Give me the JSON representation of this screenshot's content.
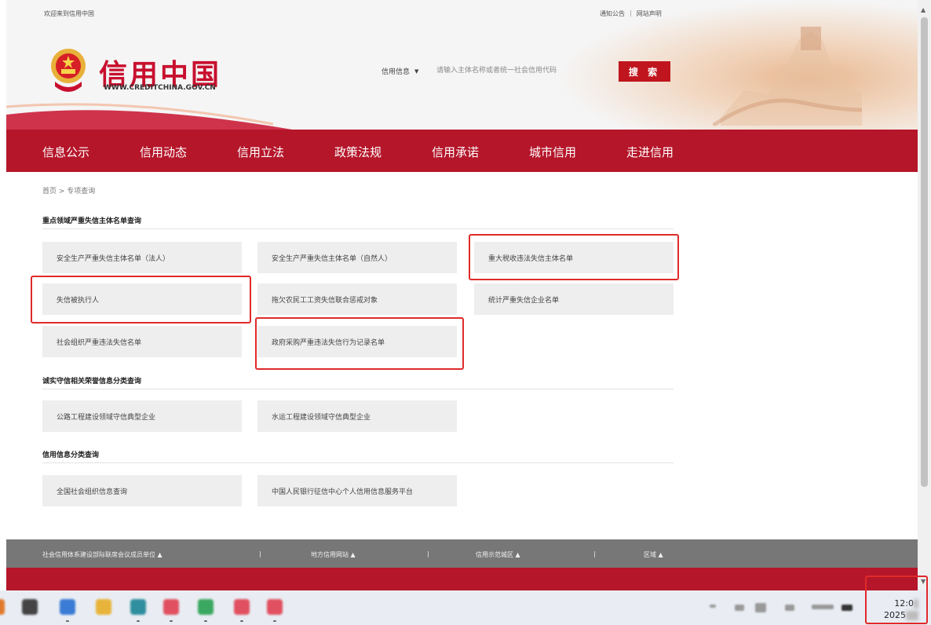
{
  "header": {
    "welcome": "欢迎来到信用中国",
    "notice": "通知公告",
    "divider": "|",
    "statement": "网站声明",
    "logo_title": "信用中国",
    "logo_url": "WWW.CREDITCHINA.GOV.CN",
    "search_type": "信用信息",
    "search_type_arrow": "▼",
    "search_placeholder": "请输入主体名称或者统一社会信用代码",
    "search_button": "搜 索"
  },
  "nav": [
    "信息公示",
    "信用动态",
    "信用立法",
    "政策法规",
    "信用承诺",
    "城市信用",
    "走进信用"
  ],
  "breadcrumb": "首页 > 专项查询",
  "sections": [
    {
      "title": "重点领域严重失信主体名单查询",
      "tiles": [
        "安全生产严重失信主体名单（法人）",
        "安全生产严重失信主体名单（自然人）",
        "重大税收违法失信主体名单",
        "失信被执行人",
        "拖欠农民工工资失信联合惩戒对象",
        "统计严重失信企业名单",
        "社会组织严重违法失信名单",
        "政府采购严重违法失信行为记录名单"
      ]
    },
    {
      "title": "诚实守信相关荣誉信息分类查询",
      "tiles": [
        "公路工程建设领域守信典型企业",
        "水运工程建设领域守信典型企业"
      ]
    },
    {
      "title": "信用信息分类查询",
      "tiles": [
        "全国社会组织信息查询",
        "中国人民银行征信中心个人信用信息服务平台"
      ]
    }
  ],
  "footer": {
    "links": [
      "社会信用体系建设部际联席会议成员单位 ▲",
      "地方信用网站 ▲",
      "信用示范城区 ▲",
      "区域 ▲"
    ],
    "separator": "|"
  },
  "scrollbar": {
    "up": "▲",
    "down": "▼"
  },
  "taskbar": {
    "time": "12:0",
    "date": "2025"
  },
  "colors": {
    "brand_red": "#b5162a",
    "search_red": "#c0151f",
    "highlight": "#e02a2a",
    "tile_bg": "#eeeeee",
    "footer_gray": "#777777"
  }
}
